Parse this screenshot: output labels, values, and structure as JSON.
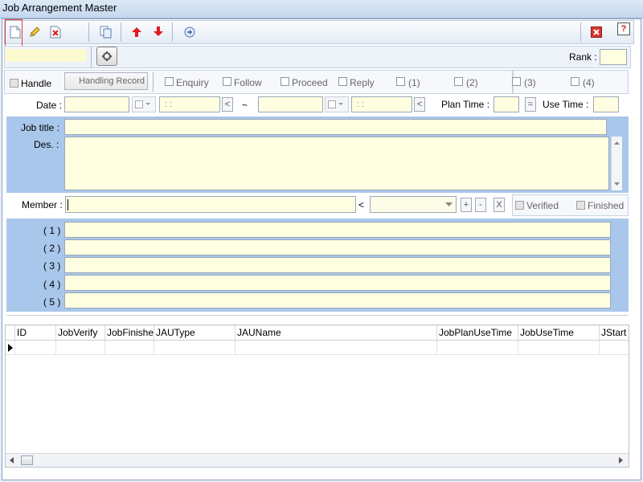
{
  "window": {
    "title": "Job Arrangement Master"
  },
  "toolbar": {
    "buttons": [
      {
        "name": "new-doc-icon"
      },
      {
        "name": "edit-pencil-icon"
      },
      {
        "name": "delete-doc-icon"
      },
      {
        "name": "copy-icon"
      },
      {
        "name": "move-up-icon"
      },
      {
        "name": "move-down-icon"
      },
      {
        "name": "refresh-icon"
      }
    ],
    "close_icon": "close-icon",
    "help_label": "?"
  },
  "header": {
    "code_value": "",
    "rank_label": "Rank :",
    "rank_value": ""
  },
  "status": {
    "handle_label": "Handle",
    "handling_record_label": "Handling Record",
    "checks": [
      "Enquiry",
      "Follow",
      "Proceed",
      "Reply",
      "(1)",
      "(2)",
      "(3)",
      "(4)"
    ]
  },
  "date_row": {
    "date_label": "Date :",
    "time_placeholder": ": :",
    "lt": "<",
    "tilde": "~",
    "plan_time_label": "Plan Time :",
    "equals": "=",
    "use_time_label": "Use Time :"
  },
  "job": {
    "title_label": "Job title :",
    "des_label": "Des. :"
  },
  "member": {
    "label": "Member :",
    "lt": "<",
    "plus": "+",
    "minus": "-",
    "x": "X",
    "verified_label": "Verified",
    "finished_label": "Finished"
  },
  "numbered": [
    "( 1 )",
    "( 2 )",
    "( 3 )",
    "( 4 )",
    "( 5 )"
  ],
  "grid": {
    "columns": [
      "ID",
      "JobVerify",
      "JobFinished",
      "JAUType",
      "JAUName",
      "JobPlanUseTime",
      "JobUseTime",
      "JStart"
    ]
  }
}
